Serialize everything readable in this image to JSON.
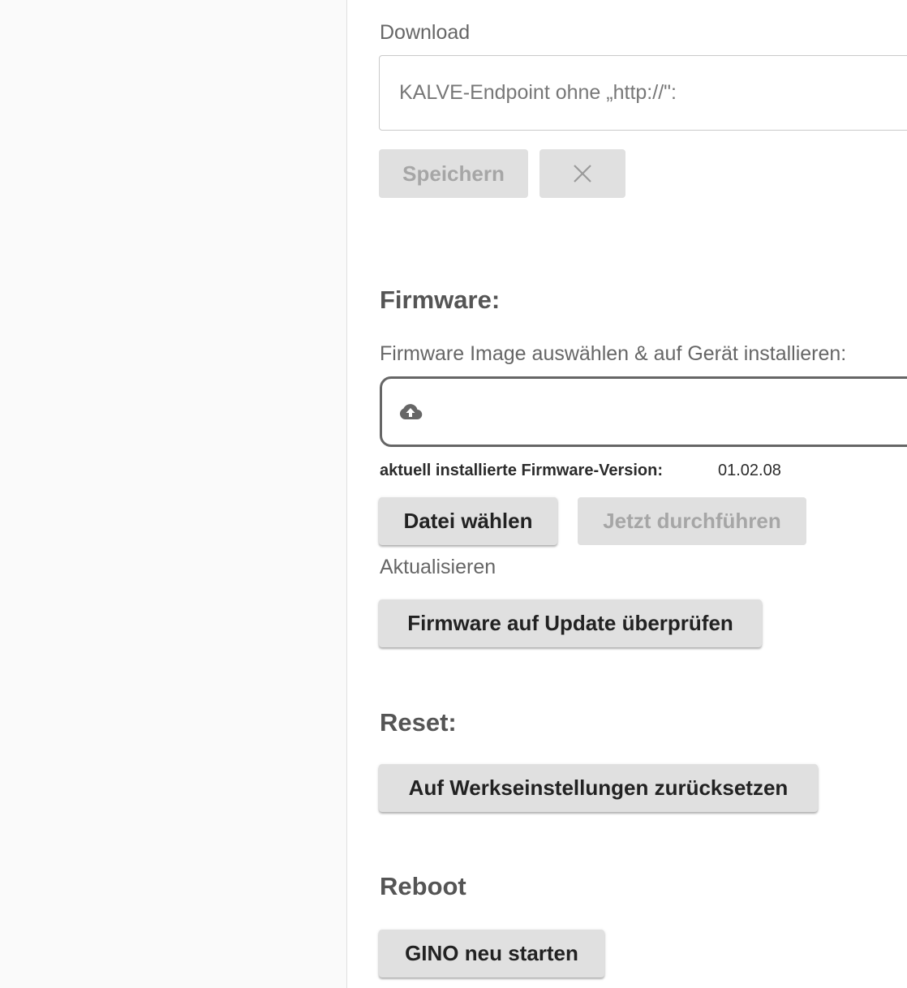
{
  "download": {
    "label": "Download",
    "endpoint_placeholder": "KALVE-Endpoint ohne „http://\":",
    "save_label": "Speichern",
    "cancel_icon": "close-icon"
  },
  "firmware": {
    "heading": "Firmware:",
    "image_label": "Firmware Image auswählen & auf Gerät installieren:",
    "upload_icon": "cloud-upload-icon",
    "version_label": "aktuell installierte Firmware-Version:",
    "version_value": "01.02.08",
    "choose_file_label": "Datei wählen",
    "run_now_label": "Jetzt durchführen",
    "update_label": "Aktualisieren",
    "check_update_label": "Firmware auf Update überprüfen"
  },
  "reset": {
    "heading": "Reset:",
    "factory_reset_label": "Auf Werkseinstellungen zurücksetzen"
  },
  "reboot": {
    "heading": "Reboot",
    "restart_label": "GINO neu starten"
  }
}
